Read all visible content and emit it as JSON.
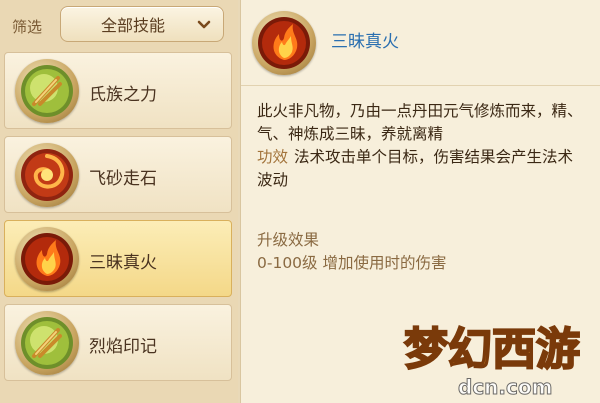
{
  "filter": {
    "label": "筛选",
    "selected": "全部技能",
    "dropdown_icon": "chevron-down-icon"
  },
  "skills": [
    {
      "name": "氏族之力",
      "icon": "green-feather-icon",
      "selected": false
    },
    {
      "name": "飞砂走石",
      "icon": "red-swirl-icon",
      "selected": false
    },
    {
      "name": "三昧真火",
      "icon": "fire-icon",
      "selected": true
    },
    {
      "name": "烈焰印记",
      "icon": "green-feather-icon",
      "selected": false
    }
  ],
  "detail": {
    "title": "三昧真火",
    "icon": "fire-icon",
    "description": "此火非凡物，乃由一点丹田元气修炼而来，精、气、神炼成三昧，养就离精",
    "effect_label": "功效",
    "effect_text": "法术攻击单个目标，伤害结果会产生法术波动",
    "upgrade_title": "升级效果",
    "upgrade_text": "0-100级 增加使用时的伤害"
  },
  "watermark": {
    "logo_text": "梦幻西游",
    "site_text": "dcn.com"
  },
  "colors": {
    "title_blue": "#2a6fb0",
    "effect_label": "#a3743b",
    "selected_bg": "#f4d888"
  }
}
